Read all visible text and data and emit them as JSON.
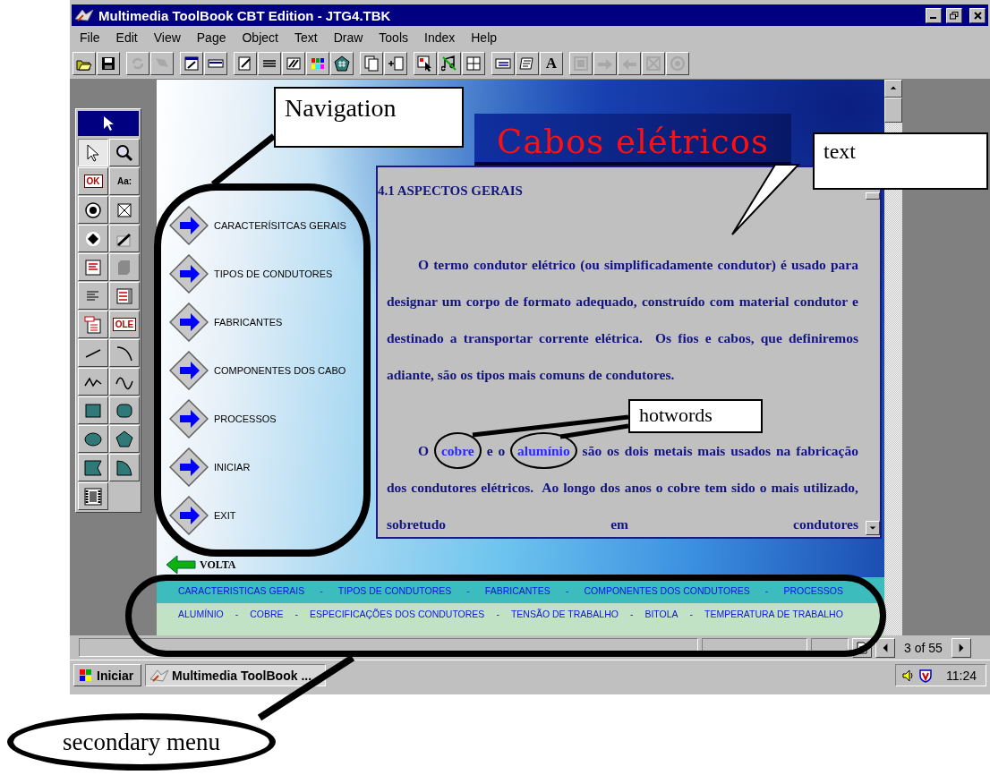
{
  "window": {
    "title": "Multimedia ToolBook CBT Edition - JTG4.TBK"
  },
  "menu": [
    "File",
    "Edit",
    "View",
    "Page",
    "Object",
    "Text",
    "Draw",
    "Tools",
    "Index",
    "Help"
  ],
  "toolbar": [
    [
      {
        "kind": "open",
        "disabled": false
      },
      {
        "kind": "save",
        "disabled": false
      }
    ],
    [
      {
        "kind": "refresh",
        "disabled": true
      },
      {
        "kind": "flag",
        "disabled": true
      }
    ],
    [
      {
        "kind": "window",
        "disabled": false
      },
      {
        "kind": "bar",
        "disabled": false
      }
    ],
    [
      {
        "kind": "pencil",
        "disabled": false
      },
      {
        "kind": "lines",
        "disabled": false
      },
      {
        "kind": "stripes",
        "disabled": false
      },
      {
        "kind": "colors",
        "disabled": false
      },
      {
        "kind": "pentagon",
        "disabled": false
      }
    ],
    [
      {
        "kind": "page",
        "disabled": false
      },
      {
        "kind": "newpage",
        "disabled": false
      }
    ],
    [
      {
        "kind": "cursor",
        "disabled": false
      },
      {
        "kind": "music",
        "disabled": false
      },
      {
        "kind": "grid",
        "disabled": false
      }
    ],
    [
      {
        "kind": "list",
        "disabled": false
      },
      {
        "kind": "script",
        "disabled": false
      },
      {
        "kind": "letter",
        "label": "A",
        "disabled": false
      }
    ],
    [
      {
        "kind": "frame",
        "disabled": true
      },
      {
        "kind": "right",
        "disabled": true
      },
      {
        "kind": "left",
        "disabled": true
      },
      {
        "kind": "xbox",
        "disabled": true
      },
      {
        "kind": "circle",
        "disabled": true
      }
    ]
  ],
  "palette": [
    {
      "kind": "select",
      "selected": true
    },
    {
      "kind": "zoom",
      "selected": false
    },
    {
      "kind": "button",
      "label": "OK",
      "selected": false
    },
    {
      "kind": "field",
      "label": "Aa:",
      "selected": false
    },
    {
      "kind": "radio",
      "selected": false
    },
    {
      "kind": "check",
      "selected": false
    },
    {
      "kind": "dot",
      "selected": false
    },
    {
      "kind": "draw",
      "selected": false
    },
    {
      "kind": "textfield",
      "selected": false
    },
    {
      "kind": "blob",
      "selected": false
    },
    {
      "kind": "align",
      "selected": false
    },
    {
      "kind": "combo",
      "selected": false
    },
    {
      "kind": "record",
      "selected": false
    },
    {
      "kind": "ole",
      "label": "OLE",
      "selected": false
    },
    {
      "kind": "line",
      "selected": false
    },
    {
      "kind": "arc",
      "selected": false
    },
    {
      "kind": "polyline",
      "selected": false
    },
    {
      "kind": "curve",
      "selected": false
    },
    {
      "kind": "rect",
      "selected": false
    },
    {
      "kind": "roundrect",
      "selected": false
    },
    {
      "kind": "ellipse",
      "selected": false
    },
    {
      "kind": "polygon",
      "selected": false
    },
    {
      "kind": "irregular",
      "selected": false
    },
    {
      "kind": "pie",
      "selected": false
    },
    {
      "kind": "video",
      "selected": false
    }
  ],
  "page": {
    "title": "Cabos elétricos",
    "nav": [
      "CARACTERÍSITCAS GERAIS",
      "TIPOS DE CONDUTORES",
      "FABRICANTES",
      "COMPONENTES DOS CABO",
      "PROCESSOS",
      "INICIAR",
      "EXIT"
    ],
    "back": "VOLTA",
    "text_panel": {
      "heading": "4.1 ASPECTOS GERAIS",
      "paragraphs": [
        [
          {
            "text": "O termo condutor elétrico (ou simplificadamente condutor) é usado para designar um corpo de formato adequado, construído com material condutor e destinado a transportar corrente elétrica.  Os fios e cabos, que definiremos adiante, são os tipos mais comuns de condutores.",
            "hotword": false
          }
        ],
        [
          {
            "text": "O ",
            "hotword": false
          },
          {
            "text": "cobre",
            "hotword": true
          },
          {
            "text": " e o ",
            "hotword": false
          },
          {
            "text": "alumínio",
            "hotword": true
          },
          {
            "text": " são os dois metais mais usados na fabricação dos condutores elétricos.  Ao longo dos anos o cobre tem sido o mais utilizado, sobretudo em condutores",
            "hotword": false
          }
        ]
      ]
    },
    "menu_rows": [
      [
        "CARACTERISTICAS GERAIS",
        "-",
        "TIPOS DE CONDUTORES",
        "-",
        "FABRICANTES",
        "-",
        "COMPONENTES DOS CONDUTORES",
        "-",
        "PROCESSOS"
      ],
      [
        "ALUMÍNIO",
        "-",
        "COBRE",
        "-",
        "ESPECIFICAÇÕES DOS CONDUTORES",
        "-",
        "TENSÃO DE TRABALHO",
        "-",
        "BITOLA",
        "-",
        "TEMPERATURA DE TRABALHO"
      ]
    ]
  },
  "status_bar": {
    "page": "3 of 55"
  },
  "taskbar": {
    "start": "Iniciar",
    "task": "Multimedia ToolBook ...",
    "clock": "11:24"
  },
  "annotations": {
    "navigation": "Navigation",
    "text": "text",
    "hotwords": "hotwords",
    "secondary_menu": "secondary menu"
  }
}
